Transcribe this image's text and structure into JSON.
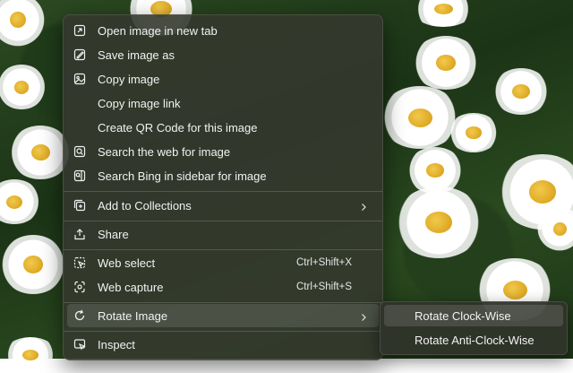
{
  "menu": {
    "items": [
      {
        "label": "Open image in new tab",
        "icon": "open-in-new-tab-icon"
      },
      {
        "label": "Save image as",
        "icon": "save-image-icon"
      },
      {
        "label": "Copy image",
        "icon": "copy-image-icon"
      },
      {
        "label": "Copy image link",
        "icon": ""
      },
      {
        "label": "Create QR Code for this image",
        "icon": ""
      },
      {
        "label": "Search the web for image",
        "icon": "visual-search-icon"
      },
      {
        "label": "Search Bing in sidebar for image",
        "icon": "sidebar-search-icon"
      },
      {
        "label": "Add to Collections",
        "icon": "collections-icon"
      },
      {
        "label": "Share",
        "icon": "share-icon"
      },
      {
        "label": "Web select",
        "icon": "web-select-icon",
        "shortcut": "Ctrl+Shift+X"
      },
      {
        "label": "Web capture",
        "icon": "web-capture-icon",
        "shortcut": "Ctrl+Shift+S"
      },
      {
        "label": "Rotate Image",
        "icon": "rotate-icon"
      },
      {
        "label": "Inspect",
        "icon": "inspect-icon"
      }
    ]
  },
  "submenu": {
    "items": [
      {
        "label": "Rotate Clock-Wise"
      },
      {
        "label": "Rotate Anti-Clock-Wise"
      }
    ]
  }
}
